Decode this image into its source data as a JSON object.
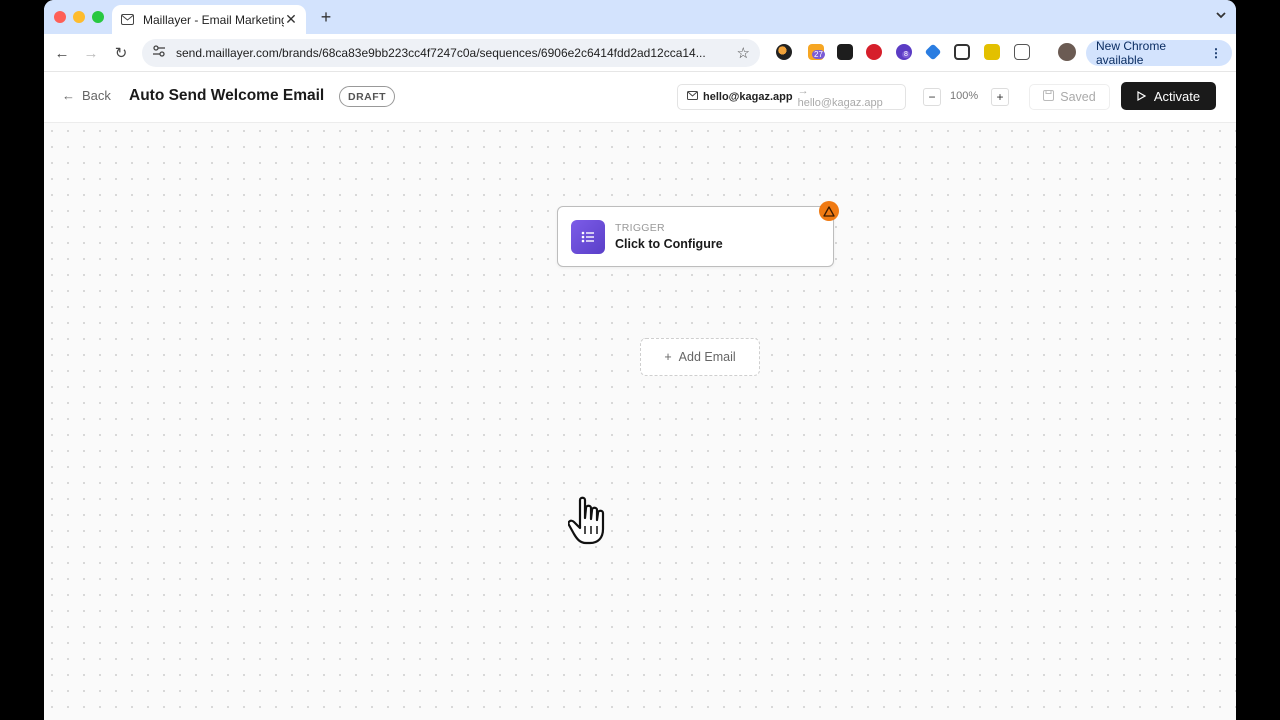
{
  "browser": {
    "tab_title": "Maillayer - Email Marketing P",
    "url": "send.maillayer.com/brands/68ca83e9bb223cc4f7247c0a/sequences/6906e2c6414fdd2ad12cca14...",
    "new_chrome_label": "New Chrome available",
    "extension_badges": {
      "calendar": "27",
      "shield": "8"
    }
  },
  "header": {
    "back_label": "Back",
    "title": "Auto Send Welcome Email",
    "status_badge": "DRAFT",
    "sender_from": "hello@kagaz.app",
    "sender_to": "→ hello@kagaz.app",
    "zoom_level": "100%",
    "zoom_minus": "−",
    "zoom_plus": "+",
    "saved_label": "Saved",
    "activate_label": "Activate"
  },
  "canvas": {
    "trigger_node": {
      "label": "TRIGGER",
      "title": "Click to Configure"
    },
    "add_email_label": "Add Email"
  },
  "colors": {
    "accent_purple": "#6b4ee0",
    "warning_orange": "#f07a12",
    "activate_bg": "#1a1a1a",
    "tabstrip_bg": "#d3e3fd"
  }
}
